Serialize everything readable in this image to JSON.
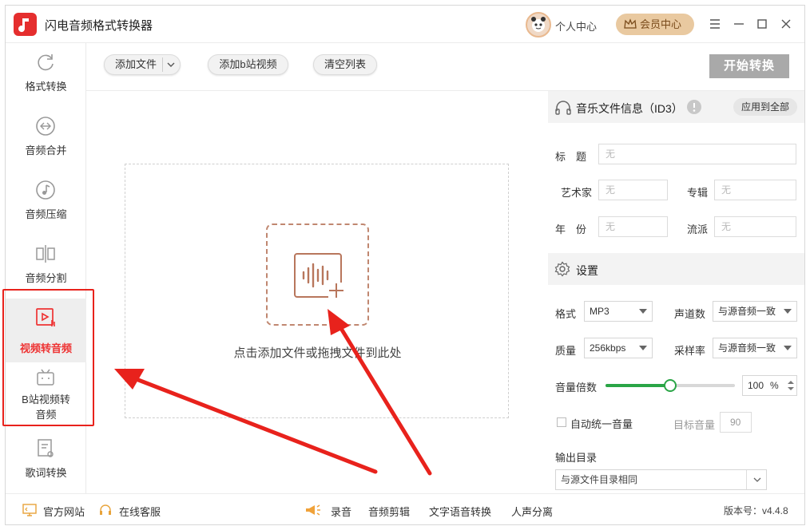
{
  "app": {
    "title": "闪电音频格式转换器"
  },
  "header": {
    "personal_center": "个人中心",
    "vip_center": "会员中心"
  },
  "sidebar": {
    "items": [
      {
        "label": "格式转换"
      },
      {
        "label": "音频合并"
      },
      {
        "label": "音频压缩"
      },
      {
        "label": "音频分割"
      },
      {
        "label": "视频转音频"
      },
      {
        "label_line1": "B站视频转",
        "label_line2": "音频"
      },
      {
        "label": "歌词转换"
      }
    ]
  },
  "toolbar": {
    "add_file": "添加文件",
    "add_bilibili": "添加b站视频",
    "clear_list": "清空列表",
    "start": "开始转换"
  },
  "dropzone": {
    "hint": "点击添加文件或拖拽文件到此处"
  },
  "id3": {
    "section_title": "音乐文件信息（ID3）",
    "apply_all": "应用到全部",
    "title_label": "标　题",
    "artist_label": "艺术家",
    "album_label": "专辑",
    "year_label": "年　份",
    "genre_label": "流派",
    "placeholder": "无"
  },
  "settings": {
    "section_title": "设置",
    "format_label": "格式",
    "format_value": "MP3",
    "channel_label": "声道数",
    "channel_value": "与源音频一致",
    "quality_label": "质量",
    "quality_value": "256kbps",
    "samplerate_label": "采样率",
    "samplerate_value": "与源音频一致",
    "volume_label": "音量倍数",
    "volume_value": "100",
    "volume_unit": "%",
    "volume_fraction": 0.5,
    "auto_normalize_label": "自动统一音量",
    "target_volume_label": "目标音量",
    "target_volume_value": "90",
    "output_dir_label": "输出目录",
    "output_dir_value": "与源文件目录相同"
  },
  "footer": {
    "website": "官方网站",
    "support": "在线客服",
    "record": "录音",
    "audio_edit": "音频剪辑",
    "tts": "文字语音转换",
    "vocal_sep": "人声分离",
    "version": "版本号：v4.4.8"
  },
  "colors": {
    "brand_red": "#e52e2e",
    "annotation_red": "#e8221c",
    "slider_green": "#2aa546",
    "start_btn_gray": "#a9a9a9"
  }
}
